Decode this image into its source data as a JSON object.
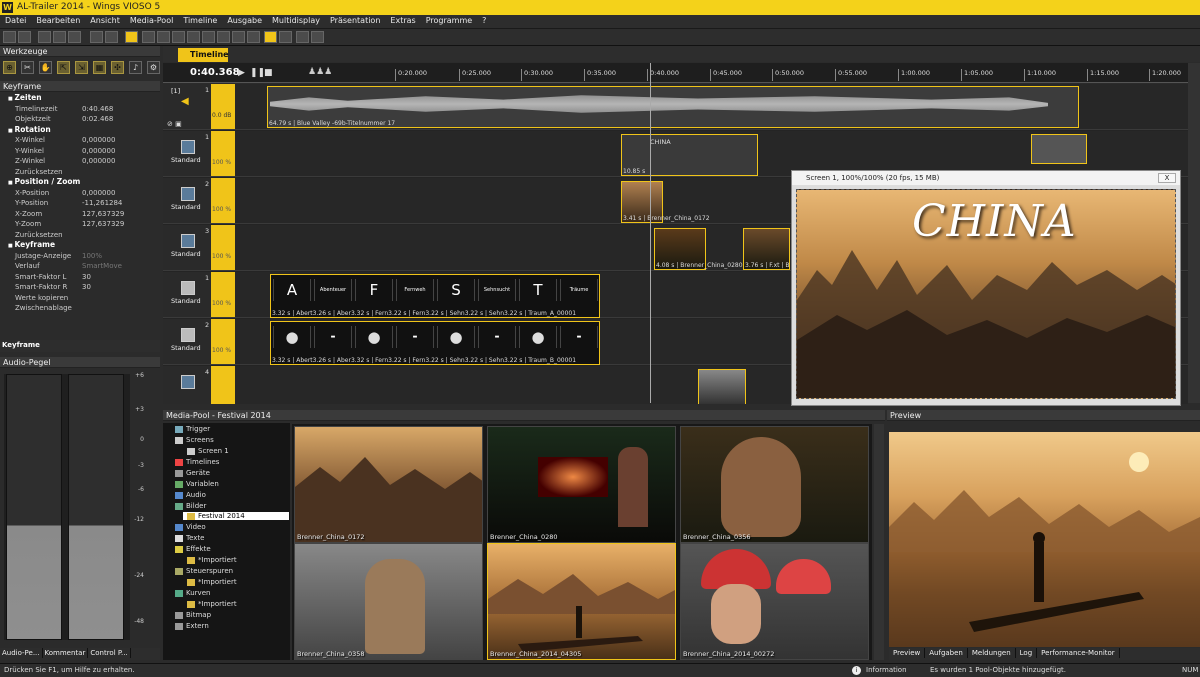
{
  "window": {
    "title": "AL-Trailer 2014 - Wings VIOSO 5",
    "logo": "W"
  },
  "menu": [
    "Datei",
    "Bearbeiten",
    "Ansicht",
    "Media-Pool",
    "Timeline",
    "Ausgabe",
    "Multidisplay",
    "Präsentation",
    "Extras",
    "Programme",
    "?"
  ],
  "panels": {
    "werkzeuge": "Werkzeuge",
    "keyframe": "Keyframe",
    "audio_pegel": "Audio-Pegel",
    "media_pool": "Media-Pool - Festival 2014",
    "preview": "Preview"
  },
  "keyframe_rows": [
    {
      "section": true,
      "k": "Zeiten",
      "v": ""
    },
    {
      "k": "Timelinezeit",
      "v": "0:40.468"
    },
    {
      "k": "Objektzeit",
      "v": "0:02.468"
    },
    {
      "section": true,
      "k": "Rotation",
      "v": ""
    },
    {
      "k": "X-Winkel",
      "v": "0,000000"
    },
    {
      "k": "Y-Winkel",
      "v": "0,000000"
    },
    {
      "k": "Z-Winkel",
      "v": "0,000000"
    },
    {
      "k": "Zurücksetzen",
      "v": ""
    },
    {
      "section": true,
      "k": "Position / Zoom",
      "v": ""
    },
    {
      "k": "X-Position",
      "v": "0,000000"
    },
    {
      "k": "Y-Position",
      "v": "-11,261284"
    },
    {
      "k": "X-Zoom",
      "v": "127,637329"
    },
    {
      "k": "Y-Zoom",
      "v": "127,637329"
    },
    {
      "k": "Zurücksetzen",
      "v": ""
    },
    {
      "section": true,
      "k": "Keyframe",
      "v": ""
    },
    {
      "k": "Justage-Anzeige",
      "v": "100%"
    },
    {
      "k": "Verlauf",
      "v": "SmartMove"
    },
    {
      "k": "Smart-Faktor L",
      "v": "30"
    },
    {
      "k": "Smart-Faktor R",
      "v": "30"
    },
    {
      "k": "Werte kopieren",
      "v": ""
    },
    {
      "k": "Zwischenablage",
      "v": ""
    }
  ],
  "kf_tab": "Keyframe",
  "meter_scale": [
    "+6",
    "+3",
    "0",
    "-3",
    "-6",
    "-12",
    "-24",
    "-48"
  ],
  "bottom_tabs": [
    "Audio-Pe...",
    "Kommentar",
    "Control P..."
  ],
  "timeline": {
    "tab": "Timeline 1",
    "timecode": "0:40.368",
    "ticks": [
      "0:20.000",
      "0:25.000",
      "0:30.000",
      "0:35.000",
      "0:40.000",
      "0:45.000",
      "0:50.000",
      "0:55.000",
      "1:00.000",
      "1:05.000",
      "1:10.000",
      "1:15.000",
      "1:20.000"
    ],
    "audio_track": {
      "id": "[1]",
      "num": "1",
      "db": "0.0 dB",
      "clip": "64.79 s | Blue Valley -69b-Titelnummer 17"
    },
    "tracks": [
      {
        "num": "1",
        "label": "Standard",
        "pct": "100 %"
      },
      {
        "num": "2",
        "label": "Standard",
        "pct": "100 %"
      },
      {
        "num": "3",
        "label": "Standard",
        "pct": "100 %"
      },
      {
        "num": "1",
        "label": "Standard",
        "pct": "100 %"
      },
      {
        "num": "2",
        "label": "Standard",
        "pct": "100 %"
      },
      {
        "num": "4",
        "label": "",
        "pct": ""
      }
    ],
    "clips": {
      "china_text": "CHINA",
      "china_dur": "10.85 s",
      "c0172": "3.41 s | Brenner_China_0172",
      "c0280": "4.08 s | Brenner_China_0280",
      "c_fxt": "3.76 s | F.xt | B",
      "row4": "3.32 s | Abert3.26 s | Aber3.32 s | Fern3.22 s | Fern3.22 s | Sehn3.22 s | Sehn3.22 s | Traum_A_00001",
      "row5": "3.32 s | Abert3.26 s | Aber3.32 s | Fern3.22 s | Fern3.22 s | Sehn3.22 s | Sehn3.22 s | Traum_B_00001",
      "letters": [
        "A",
        "Abenteuer",
        "F",
        "Fernweh",
        "S",
        "Sehnsucht",
        "T",
        "Träume"
      ]
    }
  },
  "screen_window": {
    "title": "Screen 1, 100%/100% (20 fps, 15 MB)",
    "close": "X",
    "overlay_text": "CHINA"
  },
  "media_tree": [
    {
      "label": "Trigger",
      "indent": 1
    },
    {
      "label": "Screens",
      "indent": 1
    },
    {
      "label": "Screen 1",
      "indent": 2
    },
    {
      "label": "Timelines",
      "indent": 1
    },
    {
      "label": "Geräte",
      "indent": 1
    },
    {
      "label": "Variablen",
      "indent": 1
    },
    {
      "label": "Audio",
      "indent": 1
    },
    {
      "label": "Bilder",
      "indent": 1
    },
    {
      "label": "Festival 2014",
      "indent": 2,
      "selected": true
    },
    {
      "label": "Video",
      "indent": 1
    },
    {
      "label": "Texte",
      "indent": 1
    },
    {
      "label": "Effekte",
      "indent": 1
    },
    {
      "label": "*Importiert",
      "indent": 2
    },
    {
      "label": "Steuerspuren",
      "indent": 1
    },
    {
      "label": "*Importiert",
      "indent": 2
    },
    {
      "label": "Kurven",
      "indent": 1
    },
    {
      "label": "*Importiert",
      "indent": 2
    },
    {
      "label": "Bitmap",
      "indent": 1
    },
    {
      "label": "Extern",
      "indent": 1
    }
  ],
  "thumbs": [
    "Brenner_China_0172",
    "Brenner_China_0280",
    "Brenner_China_0356",
    "Brenner_China_0358",
    "Brenner_China_2014_04305",
    "Brenner_China_2014_00272"
  ],
  "preview_tabs": [
    "Preview",
    "Aufgaben",
    "Meldungen",
    "Log",
    "Performance-Monitor"
  ],
  "status": {
    "help": "Drücken Sie F1, um Hilfe zu erhalten.",
    "info_label": "Information",
    "message": "Es wurden 1 Pool-Objekte hinzugefügt.",
    "num": "NUM"
  }
}
